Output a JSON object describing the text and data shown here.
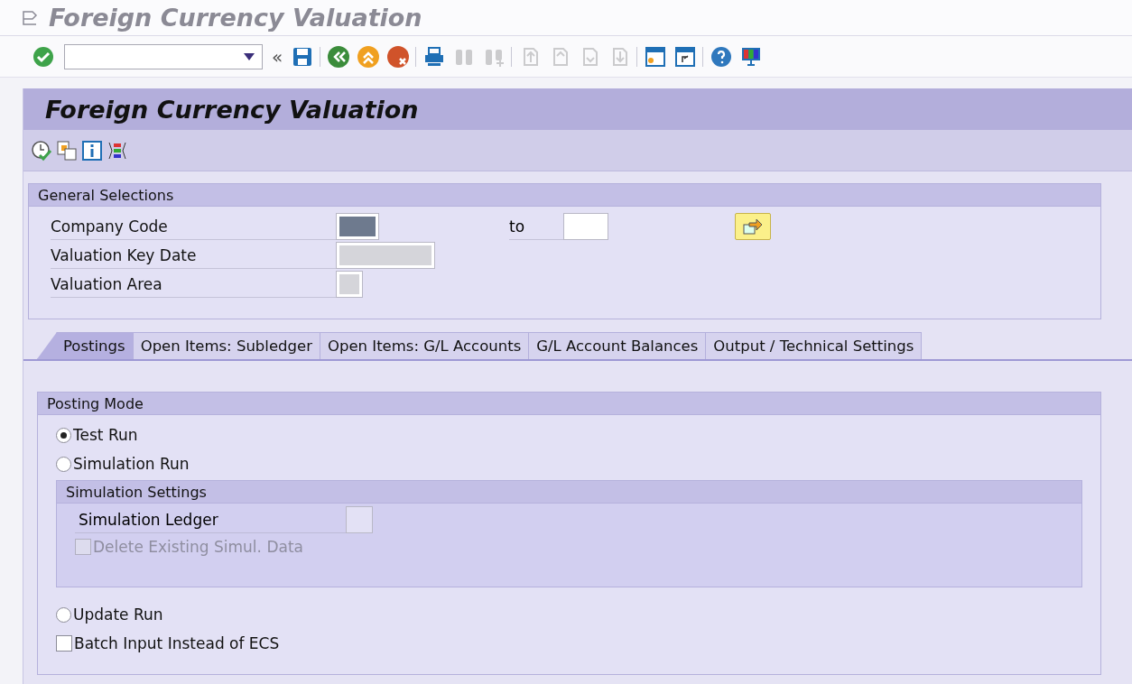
{
  "window": {
    "title": "Foreign Currency Valuation"
  },
  "toolbar": {
    "history": "«",
    "buttons": [
      {
        "disabled": false
      },
      {
        "disabled": false
      },
      {
        "disabled": false
      },
      {
        "disabled": false
      },
      {
        "disabled": false
      },
      {
        "disabled": false
      },
      {
        "disabled": true
      },
      {
        "disabled": true
      },
      {
        "disabled": true
      },
      {
        "disabled": true
      },
      {
        "disabled": true
      },
      {
        "disabled": true
      },
      {
        "disabled": false
      },
      {
        "disabled": false
      },
      {
        "disabled": false
      },
      {
        "disabled": false
      }
    ]
  },
  "screen": {
    "title": "Foreign Currency Valuation"
  },
  "general_selections": {
    "title": "General Selections",
    "fields": [
      {
        "label": "Company Code",
        "masked": true,
        "to_label": "to"
      },
      {
        "label": "Valuation Key Date",
        "masked": true
      },
      {
        "label": "Valuation Area",
        "masked": true
      }
    ]
  },
  "tabs": [
    {
      "label": "Postings",
      "selected": true
    },
    {
      "label": "Open Items: Subledger",
      "selected": false
    },
    {
      "label": "Open Items: G/L Accounts",
      "selected": false
    },
    {
      "label": "G/L Account Balances",
      "selected": false
    },
    {
      "label": "Output / Technical Settings",
      "selected": false
    }
  ],
  "posting_mode": {
    "title": "Posting Mode",
    "options": [
      {
        "kind": "radio",
        "label": "Test Run",
        "selected": true
      },
      {
        "kind": "radio",
        "label": "Simulation Run",
        "selected": false
      },
      {
        "kind": "group",
        "title": "Simulation Settings",
        "field_label": "Simulation Ledger",
        "checkbox": {
          "label": "Delete Existing Simul. Data",
          "checked": false,
          "disabled": true
        }
      },
      {
        "kind": "radio",
        "label": "Update Run",
        "selected": false
      },
      {
        "kind": "checkbox",
        "label": "Batch Input Instead of ECS",
        "checked": false
      }
    ]
  }
}
